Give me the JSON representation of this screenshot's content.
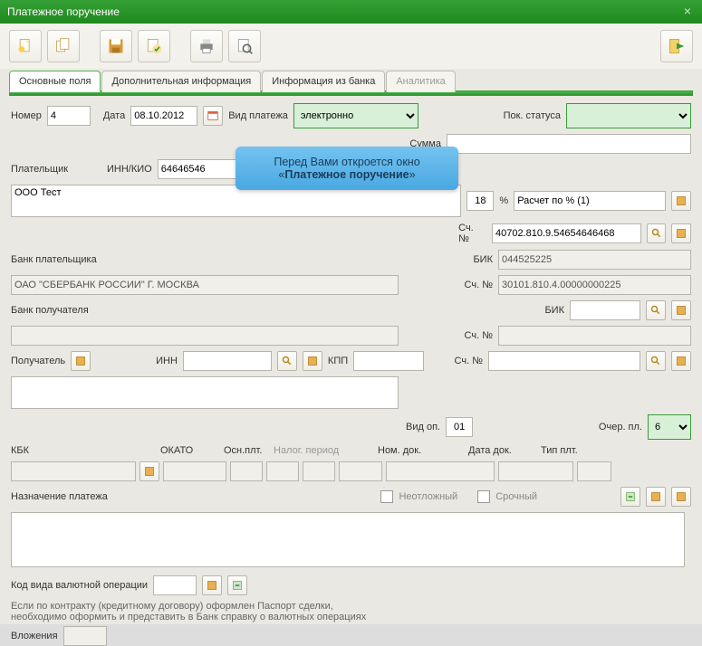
{
  "window": {
    "title": "Платежное поручение"
  },
  "tabs": {
    "main": "Основные поля",
    "extra": "Дополнительная информация",
    "bank": "Информация из банка",
    "analytics": "Аналитика"
  },
  "labels": {
    "number": "Номер",
    "date": "Дата",
    "payType": "Вид платежа",
    "payStatus": "Пок. статуса",
    "sum": "Сумма",
    "payer": "Плательщик",
    "innKio": "ИНН/КИО",
    "percent": "%",
    "percentCalc": "Расчет по % (1)",
    "acc": "Сч. №",
    "payerBank": "Банк плательщика",
    "bic": "БИК",
    "recvBank": "Банк получателя",
    "recv": "Получатель",
    "inn": "ИНН",
    "kpp": "КПП",
    "opType": "Вид оп.",
    "queue": "Очер. пл.",
    "kbk": "КБК",
    "okato": "ОКАТО",
    "osn": "Осн.плт.",
    "taxPeriod": "Налог. период",
    "docNum": "Ном. док.",
    "docDate": "Дата док.",
    "payTypeCode": "Тип плт.",
    "purpose": "Назначение платежа",
    "urgent": "Неотложный",
    "term": "Срочный",
    "currOpCode": "Код вида валютной операции",
    "note1": "Если по контракту (кредитному договору) оформлен Паспорт сделки,",
    "note2": "необходимо оформить и представить в Банк справку о валютных операциях",
    "attach": "Вложения"
  },
  "values": {
    "number": "4",
    "date": "08.10.2012",
    "payType": "электронно",
    "innKio": "64646546",
    "percent": "18",
    "payerName": "ООО Тест",
    "payerAcc": "40702.810.9.54654646468",
    "payerBankName": "ОАО \"СБЕРБАНК РОССИИ\" Г. МОСКВА",
    "payerBankBic": "044525225",
    "payerBankAcc": "30101.810.4.00000000225",
    "opType": "01",
    "queue": "6"
  },
  "tooltip": {
    "line1": "Перед Вами откроется окно",
    "line2": "«Платежное поручение»"
  }
}
